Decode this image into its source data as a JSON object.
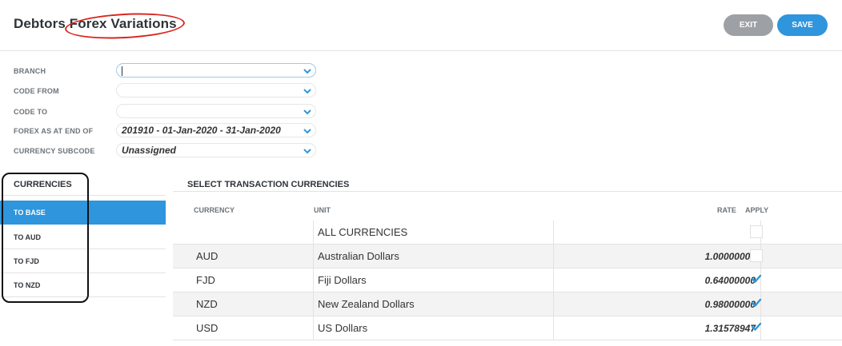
{
  "header": {
    "title": "Debtors Forex Variations",
    "exit_label": "EXIT",
    "save_label": "SAVE"
  },
  "form": {
    "branch": {
      "label": "BRANCH",
      "value": ""
    },
    "code_from": {
      "label": "CODE FROM",
      "value": ""
    },
    "code_to": {
      "label": "CODE TO",
      "value": ""
    },
    "forex_as_at": {
      "label": "FOREX AS AT END OF",
      "value": "201910 - 01-Jan-2020 - 31-Jan-2020"
    },
    "currency_subcode": {
      "label": "CURRENCY SUBCODE",
      "value": "Unassigned"
    }
  },
  "currencies_panel": {
    "title": "CURRENCIES",
    "items": [
      {
        "label": "TO BASE",
        "selected": true
      },
      {
        "label": "TO AUD",
        "selected": false
      },
      {
        "label": "TO FJD",
        "selected": false
      },
      {
        "label": "TO NZD",
        "selected": false
      }
    ]
  },
  "transactions": {
    "title": "SELECT TRANSACTION CURRENCIES",
    "columns": {
      "currency": "CURRENCY",
      "unit": "UNIT",
      "rate": "RATE",
      "apply": "APPLY"
    },
    "rows": [
      {
        "code": "",
        "unit": "ALL CURRENCIES",
        "rate": "",
        "apply": false
      },
      {
        "code": "AUD",
        "unit": "Australian Dollars",
        "rate": "1.00000000",
        "apply": false
      },
      {
        "code": "FJD",
        "unit": "Fiji Dollars",
        "rate": "0.64000000",
        "apply": true
      },
      {
        "code": "NZD",
        "unit": "New Zealand Dollars",
        "rate": "0.98000000",
        "apply": true
      },
      {
        "code": "USD",
        "unit": "US Dollars",
        "rate": "1.31578947",
        "apply": true
      }
    ]
  },
  "colors": {
    "accent": "#2f95dc",
    "exit_button": "#9da1a5",
    "annotation_red": "#d9251d",
    "annotation_black": "#111111"
  }
}
